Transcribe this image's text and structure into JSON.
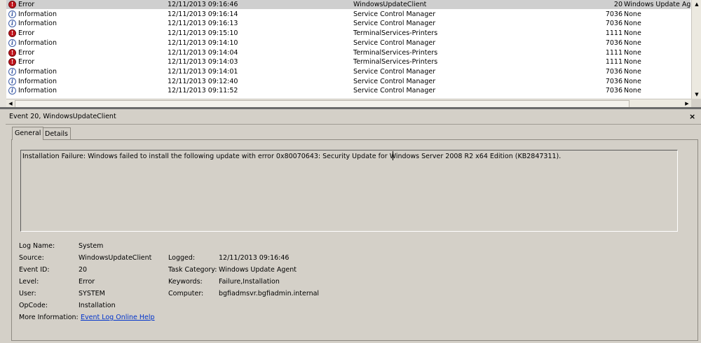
{
  "event_list": {
    "rows": [
      {
        "level": "Error",
        "date": "12/11/2013 09:16:46",
        "source": "WindowsUpdateClient",
        "event_id": "20",
        "task": "Windows Update Agent",
        "selected": true
      },
      {
        "level": "Information",
        "date": "12/11/2013 09:16:14",
        "source": "Service Control Manager",
        "event_id": "7036",
        "task": "None"
      },
      {
        "level": "Information",
        "date": "12/11/2013 09:16:13",
        "source": "Service Control Manager",
        "event_id": "7036",
        "task": "None"
      },
      {
        "level": "Error",
        "date": "12/11/2013 09:15:10",
        "source": "TerminalServices-Printers",
        "event_id": "1111",
        "task": "None"
      },
      {
        "level": "Information",
        "date": "12/11/2013 09:14:10",
        "source": "Service Control Manager",
        "event_id": "7036",
        "task": "None"
      },
      {
        "level": "Error",
        "date": "12/11/2013 09:14:04",
        "source": "TerminalServices-Printers",
        "event_id": "1111",
        "task": "None"
      },
      {
        "level": "Error",
        "date": "12/11/2013 09:14:03",
        "source": "TerminalServices-Printers",
        "event_id": "1111",
        "task": "None"
      },
      {
        "level": "Information",
        "date": "12/11/2013 09:14:01",
        "source": "Service Control Manager",
        "event_id": "7036",
        "task": "None"
      },
      {
        "level": "Information",
        "date": "12/11/2013 09:12:40",
        "source": "Service Control Manager",
        "event_id": "7036",
        "task": "None"
      },
      {
        "level": "Information",
        "date": "12/11/2013 09:11:52",
        "source": "Service Control Manager",
        "event_id": "7036",
        "task": "None"
      }
    ]
  },
  "icons": {
    "error": "error-icon",
    "information": "information-icon"
  },
  "colors": {
    "error": "#c0141c",
    "information": "#2d4f9e",
    "link": "#0033cc"
  },
  "detail": {
    "title": "Event 20, WindowsUpdateClient",
    "close_label": "×",
    "tabs": {
      "general": "General",
      "details": "Details"
    },
    "message": "Installation Failure: Windows failed to install the following update with error 0x80070643: Security Update for Windows Server 2008 R2 x64 Edition (KB2847311).",
    "properties": {
      "log_name_label": "Log Name:",
      "log_name": "System",
      "source_label": "Source:",
      "source": "WindowsUpdateClient",
      "logged_label": "Logged:",
      "logged": "12/11/2013 09:16:46",
      "event_id_label": "Event ID:",
      "event_id": "20",
      "task_category_label": "Task Category:",
      "task_category": "Windows Update Agent",
      "level_label": "Level:",
      "level": "Error",
      "keywords_label": "Keywords:",
      "keywords": "Failure,Installation",
      "user_label": "User:",
      "user": "SYSTEM",
      "computer_label": "Computer:",
      "computer": "bgfiadmsvr.bgfiadmin.internal",
      "opcode_label": "OpCode:",
      "opcode": "Installation",
      "more_info_label": "More Information:",
      "more_info_link": "Event Log Online Help"
    }
  }
}
